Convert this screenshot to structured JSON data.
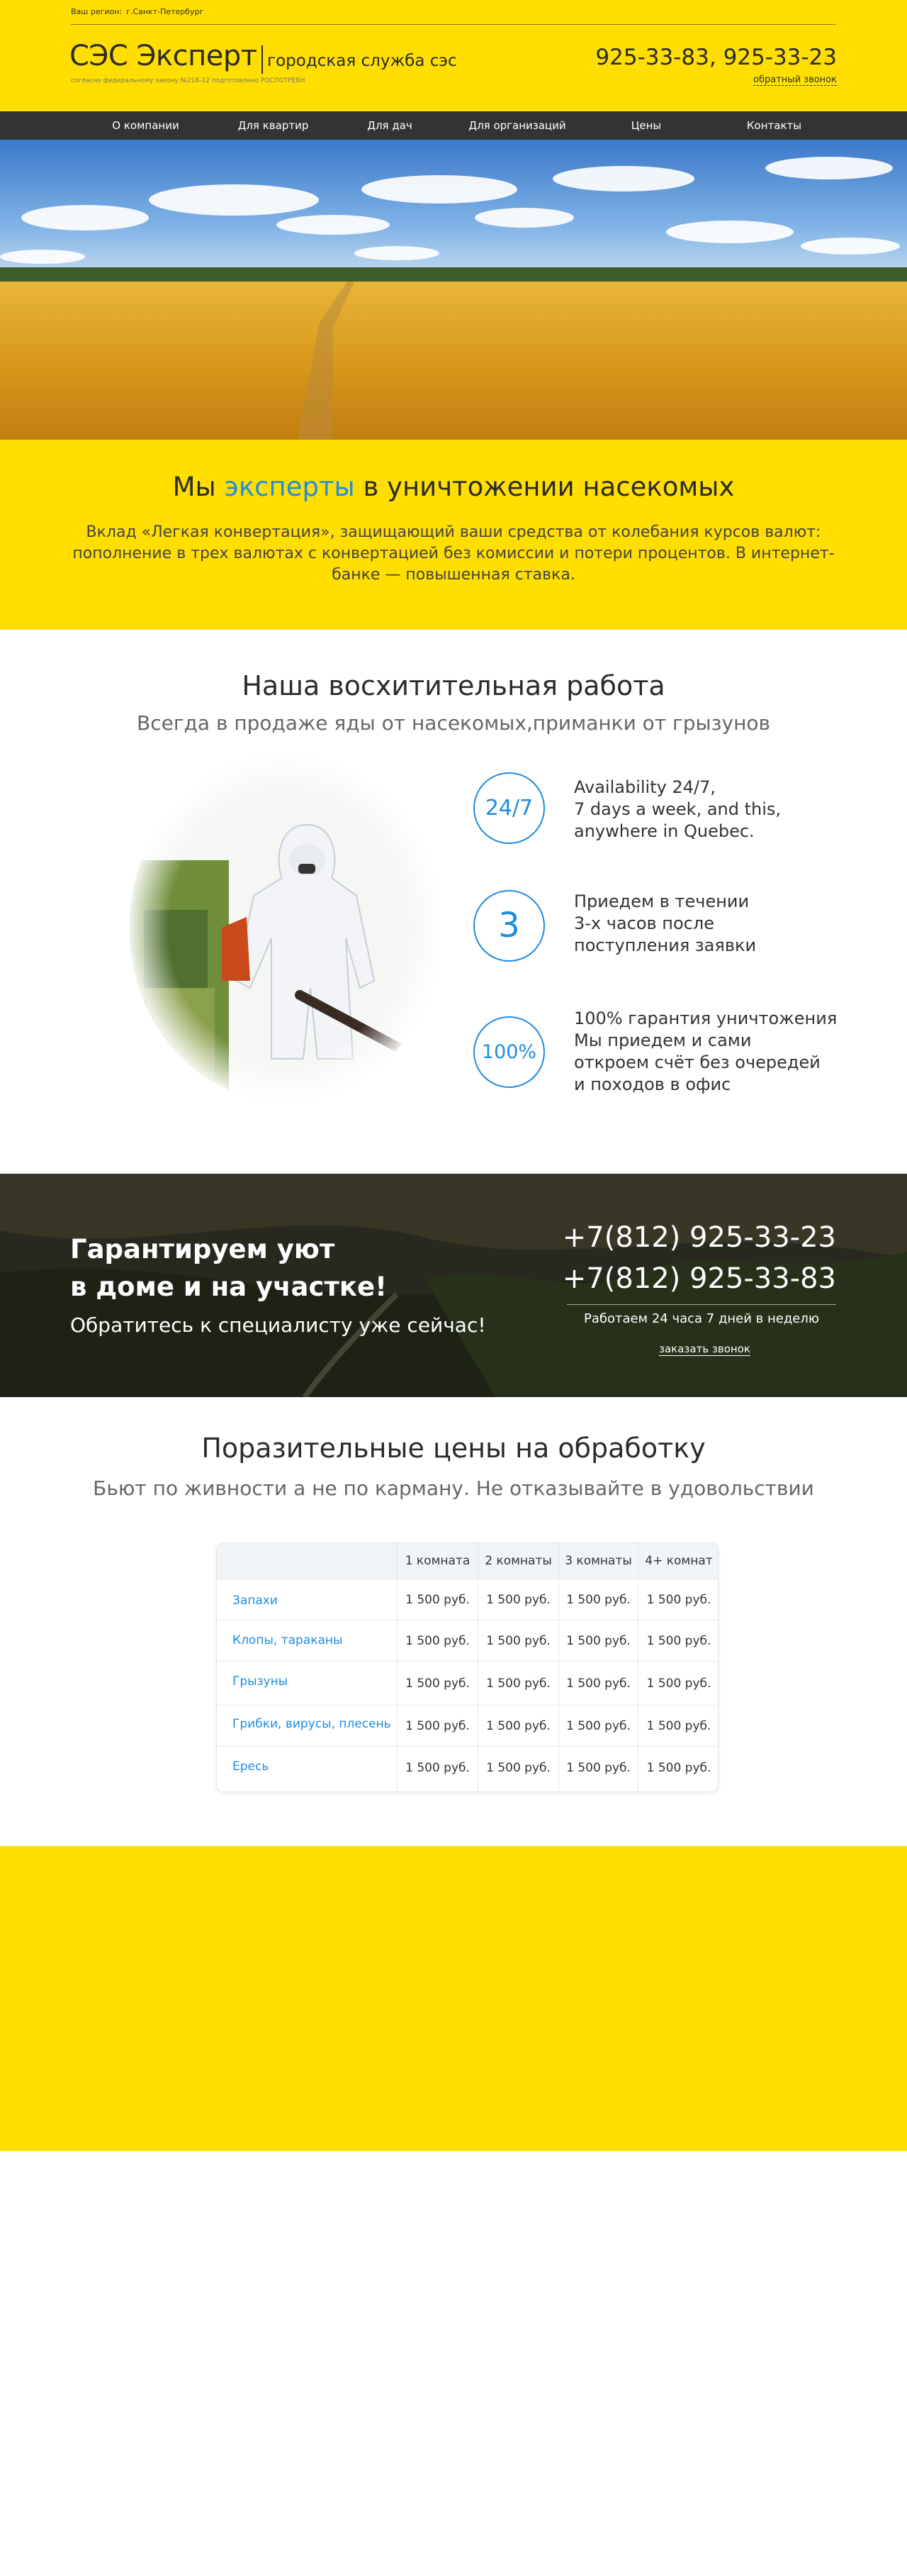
{
  "header": {
    "region_label": "Ваш регион:",
    "region_value": "г.Санкт-Петербург",
    "logo": "СЭС Эксперт",
    "logo_sub": "городская служба сэс",
    "law": "согласно федеральному закону №218-12 подготовлено РОСПОТРЕБН",
    "phones": "925-33-83, 925-33-23",
    "callback": "обратный звонок"
  },
  "nav": {
    "items": [
      "О компании",
      "Для квартир",
      "Для дач",
      "Для организаций",
      "Цены",
      "Контакты"
    ]
  },
  "intro": {
    "title_before": "Мы ",
    "title_accent": "эксперты",
    "title_after": " в уничтожении насекомых",
    "text": "Вклад «Легкая конвертация», защищающий ваши средства от колебания курсов валют: пополнение в трех валютах с конвертацией без комиссии и потери процентов. В интернет-банке — повышенная ставка."
  },
  "work": {
    "title": "Наша восхитительная работа",
    "subtitle": "Всегда в продаже яды от насекомых,приманки от грызунов",
    "features": [
      {
        "badge": "24/7",
        "lines": [
          "Availability 24/7,",
          "7 days a week, and this,",
          "anywhere in Quebec."
        ]
      },
      {
        "badge": "3",
        "lines": [
          "Приедем в течении",
          "3-х часов после",
          "поступления заявки"
        ]
      },
      {
        "badge": "100%",
        "lines": [
          "100% гарантия уничтожения",
          "Мы приедем и сами",
          "откроем счёт без очередей",
          "и походов в офис"
        ]
      }
    ]
  },
  "band": {
    "title_line1": "Гарантируем уют",
    "title_line2": "в доме и на участке!",
    "subtitle": "Обратитесь к специалисту уже сейчас!",
    "phone1": "+7(812) 925-33-23",
    "phone2": "+7(812) 925-33-83",
    "hours": "Работаем 24 часа 7 дней в неделю",
    "cta": "заказать звонок"
  },
  "prices": {
    "title": "Поразительные цены на обработку",
    "subtitle": "Бьют по живности а не по карману. Не отказывайте в удовольствии",
    "columns": [
      "",
      "1 комната",
      "2 комнаты",
      "3 комнаты",
      "4+ комнат"
    ],
    "rows": [
      {
        "name": "Запахи",
        "prices": [
          "1 500 руб.",
          "1 500 руб.",
          "1 500 руб.",
          "1 500 руб."
        ]
      },
      {
        "name": "Клопы, тараканы",
        "prices": [
          "1 500 руб.",
          "1 500 руб.",
          "1 500 руб.",
          "1 500 руб."
        ]
      },
      {
        "name": "Грызуны",
        "prices": [
          "1 500 руб.",
          "1 500 руб.",
          "1 500 руб.",
          "1 500 руб."
        ]
      },
      {
        "name": "Грибки, вирусы, плесень",
        "prices": [
          "1 500 руб.",
          "1 500 руб.",
          "1 500 руб.",
          "1 500 руб."
        ]
      },
      {
        "name": "Ересь",
        "prices": [
          "1 500 руб.",
          "1 500 руб.",
          "1 500 руб.",
          "1 500 руб."
        ]
      }
    ]
  },
  "colors": {
    "brand_yellow": "#ffde00",
    "accent_blue": "#1f8ddf",
    "nav_dark": "#333333"
  }
}
